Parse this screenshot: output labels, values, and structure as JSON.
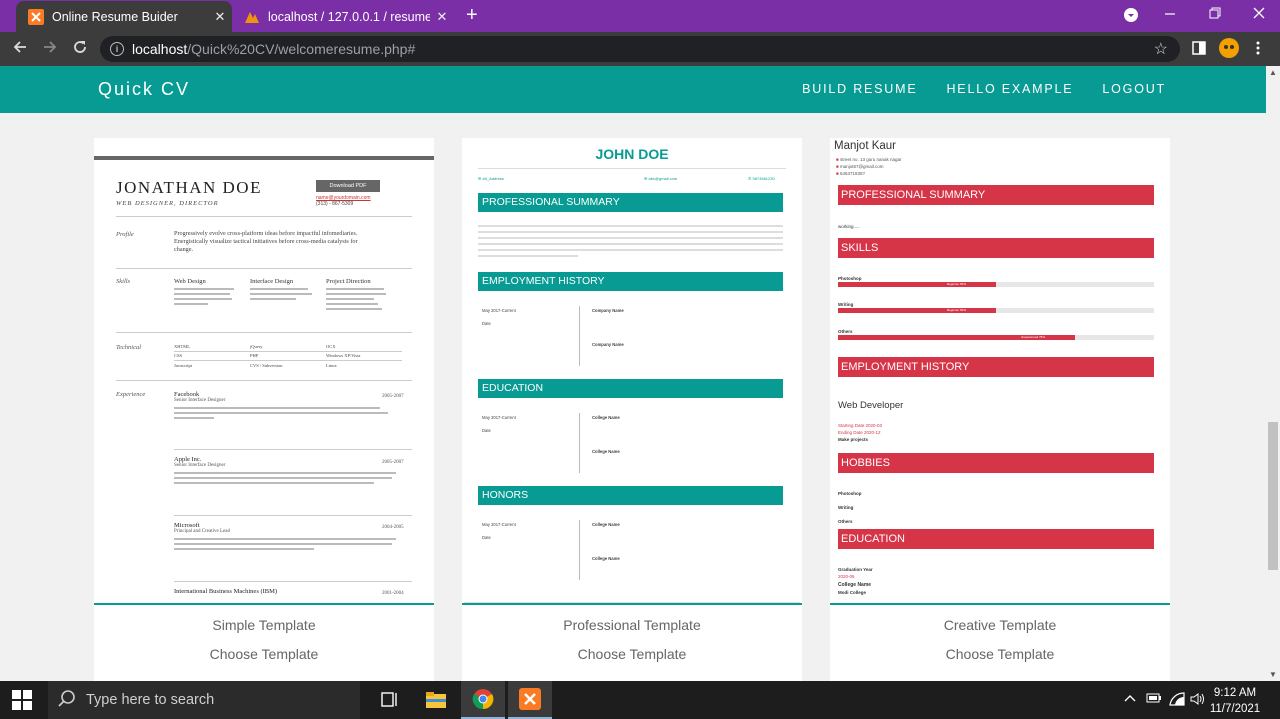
{
  "browser": {
    "tabs": [
      {
        "title": "Online Resume Buider",
        "close": "✕"
      },
      {
        "title": "localhost / 127.0.0.1 / resume / c",
        "close": "✕"
      }
    ],
    "new_tab": "+",
    "url_host": "localhost",
    "url_path": "/Quick%20CV/welcomeresume.php#"
  },
  "site": {
    "brand": "Quick CV",
    "nav": [
      "BUILD RESUME",
      "HELLO EXAMPLE",
      "LOGOUT"
    ]
  },
  "templates": [
    {
      "name": "Simple Template",
      "action": "Choose Template"
    },
    {
      "name": "Professional Template",
      "action": "Choose Template"
    },
    {
      "name": "Creative Template",
      "action": "Choose Template"
    }
  ],
  "simple_preview": {
    "name": "JONATHAN DOE",
    "subtitle": "WEB DESIGNER, DIRECTOR",
    "download": "Download PDF",
    "email": "name@yourdomain.com",
    "phone": "(313) - 867-5309",
    "profile_label": "Profile",
    "profile_text": "Progressively evolve cross-platform ideas before impactful infomediaries. Energistically visualize tactical initiatives before cross-media catalysts for change.",
    "skills_label": "Skills",
    "skills": [
      "Web Design",
      "Interface Design",
      "Project Direction"
    ],
    "technical_label": "Technical",
    "technical": [
      "XHTML",
      "jQuery",
      "OCX",
      "CSS",
      "PHP",
      "Windows XP/Vista",
      "Javascript",
      "CVS / Subversion",
      "Linux"
    ],
    "experience_label": "Experience",
    "experience": [
      {
        "company": "Facebook",
        "role": "Senior Interface Designer",
        "dates": "2005-2007"
      },
      {
        "company": "Apple Inc.",
        "role": "Senior Interface Designer",
        "dates": "2005-2007"
      },
      {
        "company": "Microsoft",
        "role": "Principal and Creative Lead",
        "dates": "2004-2005"
      },
      {
        "company": "International Business Machines (IBM)",
        "role": "",
        "dates": "2001-2004"
      }
    ]
  },
  "professional_preview": {
    "name": "JOHN DOE",
    "contact": [
      "✉ ##_Address",
      "✉ abc@gmail.com",
      "✆ 9874561230"
    ],
    "sections": [
      "PROFESSIONAL SUMMARY",
      "EMPLOYMENT HISTORY",
      "EDUCATION",
      "HONORS"
    ],
    "date_text": "May 2017-Current",
    "date_label": "Date",
    "company": "Company Name",
    "college": "College Name"
  },
  "creative_preview": {
    "name": "Manjot Kaur",
    "address": "street no. 13 guru nanak nagar",
    "email": "manjot67@gmail.com",
    "phone": "646371835?",
    "sections": [
      "PROFESSIONAL SUMMARY",
      "SKILLS",
      "EMPLOYMENT HISTORY",
      "HOBBIES",
      "EDUCATION"
    ],
    "summary": "working.....",
    "skills": [
      {
        "name": "Photoshop",
        "level": "Beginner 50%",
        "fraction": 0.5
      },
      {
        "name": "Writing",
        "level": "Beginner 50%",
        "fraction": 0.5
      },
      {
        "name": "Others",
        "level": "Experienced 75%",
        "fraction": 0.75
      }
    ],
    "job": "Web Developer",
    "start": "Starting Date 2020-03",
    "end": "Ending Date 2020-12",
    "job_desc": "Make projects",
    "hobbies": [
      "Photoshop",
      "Writing",
      "Others"
    ],
    "grad_label": "Graduation Year",
    "grad_year": "2020-06",
    "college_label": "College Name",
    "college": "Modi College"
  },
  "taskbar": {
    "search_placeholder": "Type here to search",
    "time": "9:12 AM",
    "date": "11/7/2021"
  }
}
